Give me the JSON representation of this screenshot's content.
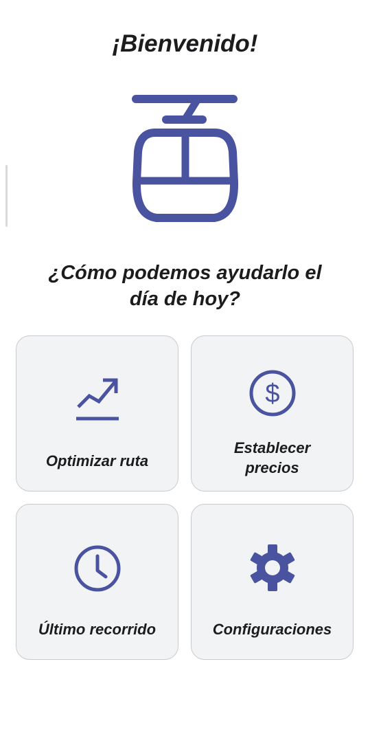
{
  "header": {
    "welcome": "¡Bienvenido!"
  },
  "hero": {
    "icon": "cable-car-icon"
  },
  "prompt": {
    "line1": "¿Cómo podemos ayudarlo el",
    "line2": "día de hoy?"
  },
  "menu": {
    "optimize": {
      "label": "Optimizar ruta",
      "icon": "trending-up-icon"
    },
    "prices": {
      "label_line1": "Establecer",
      "label_line2": "precios",
      "icon": "dollar-circle-icon"
    },
    "last_trip": {
      "label": "Último recorrido",
      "icon": "clock-icon"
    },
    "settings": {
      "label": "Configuraciones",
      "icon": "gear-icon"
    }
  },
  "colors": {
    "accent": "#4a53a0",
    "card_bg": "#f2f3f5",
    "card_border": "#c9cacf",
    "text": "#1c1c1e"
  }
}
